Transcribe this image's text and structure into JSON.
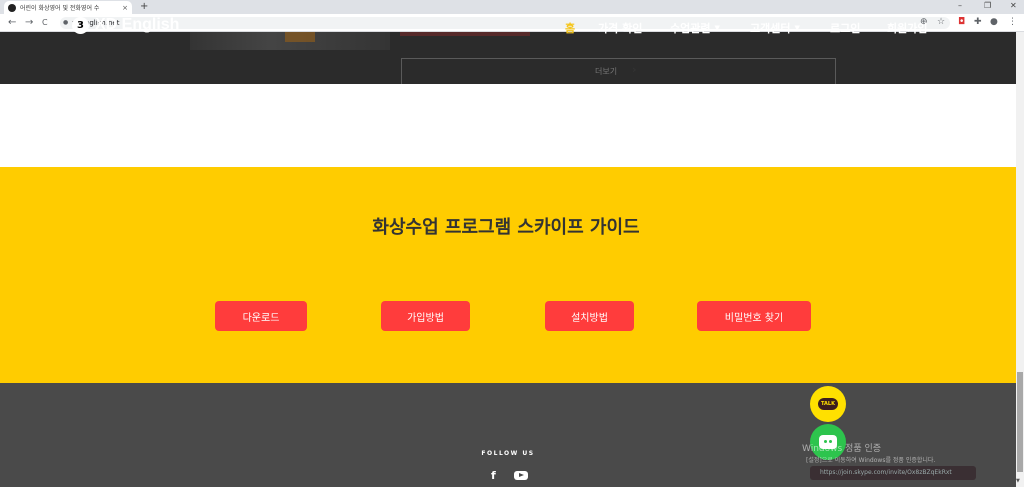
{
  "browser": {
    "tab_title": "어린이 화상영어 및 전화영어 수",
    "tab_close": "×",
    "new_tab": "+",
    "url": "xdenglish.net",
    "back": "←",
    "forward": "→",
    "reload": "C",
    "window_controls": [
      "–",
      "❐",
      "✕"
    ]
  },
  "site": {
    "logo_mark": "3",
    "logo_text": "XD English",
    "menu": [
      {
        "label": "홈",
        "active": true
      },
      {
        "label": "가격 확인"
      },
      {
        "label": "수업관련",
        "caret": "▼"
      },
      {
        "label": "고객센터",
        "caret": "▼"
      },
      {
        "label": "로그인"
      },
      {
        "label": "회원가입"
      }
    ],
    "more_label": "더보기",
    "more_arrow": "›"
  },
  "guide": {
    "title": "화상수업 프로그램 스카이프 가이드",
    "buttons": [
      "다운로드",
      "가입방법",
      "설치방법",
      "비밀번호 찾기"
    ]
  },
  "footer": {
    "follow_label": "FOLLOW US",
    "facebook": "f"
  },
  "floating": {
    "talk_label": "TALK",
    "watermark_title": "Windows 정품 인증",
    "watermark_sub": "[설정]으로 이동하여 Windows를 정품 인증합니다.",
    "skype_link": "https://join.skype.com/invite/Ox8zBZqEkRxt"
  },
  "colors": {
    "nav_bg": "#2b2b2b",
    "accent": "#f5c518",
    "section_bg": "#ffcc00",
    "button_bg": "#ff3c3c",
    "footer_bg": "#4a4a4a"
  }
}
